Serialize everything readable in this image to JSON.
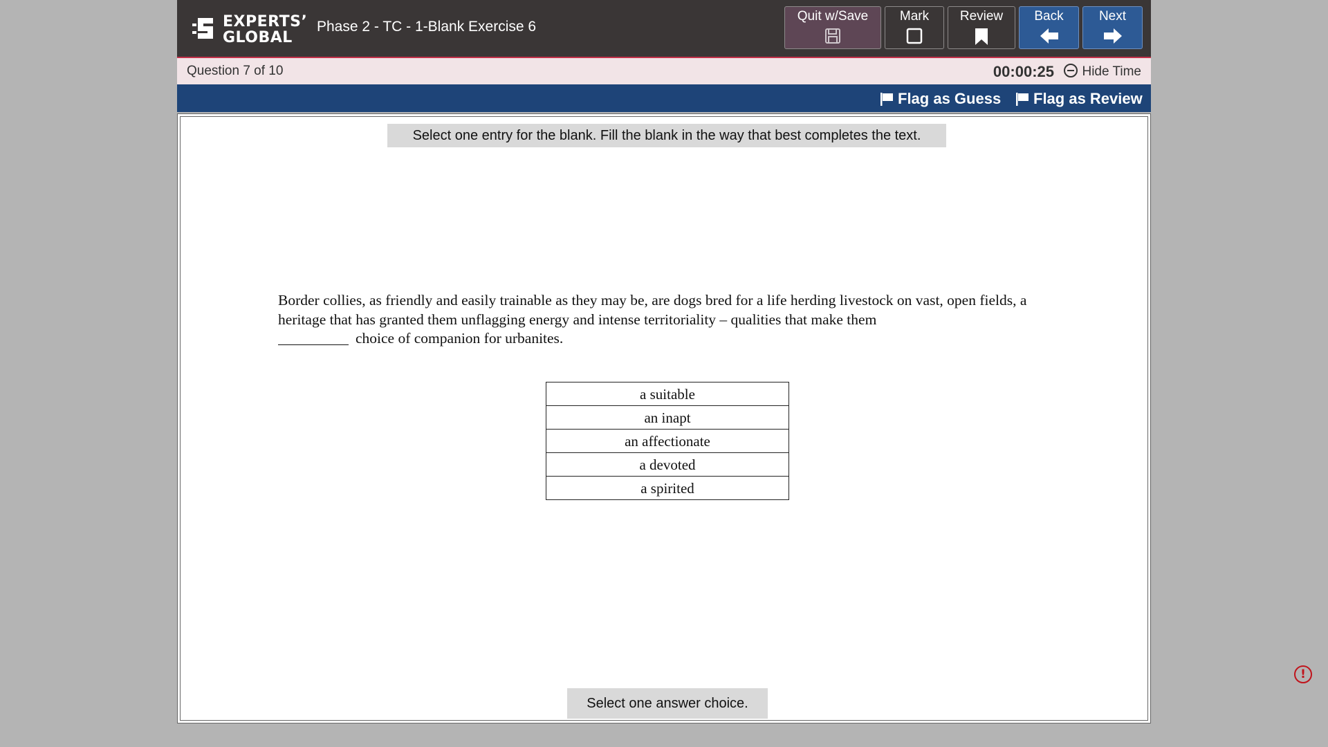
{
  "header": {
    "logo_line1": "EXPERTS’",
    "logo_line2": "GLOBAL",
    "exam_title": "Phase 2 - TC - 1-Blank Exercise 6",
    "buttons": {
      "quit": {
        "label": "Quit w/Save",
        "icon": "save-icon"
      },
      "mark": {
        "label": "Mark",
        "icon": "checkbox-icon"
      },
      "review": {
        "label": "Review",
        "icon": "bookmark-icon"
      },
      "back": {
        "label": "Back",
        "icon": "arrow-left-icon"
      },
      "next": {
        "label": "Next",
        "icon": "arrow-right-icon"
      }
    }
  },
  "question_bar": {
    "question_label": "Question 7 of 10",
    "timer": "00:00:25",
    "hide_time": "Hide Time"
  },
  "flag_bar": {
    "flag_guess": "Flag as Guess",
    "flag_review": "Flag as Review"
  },
  "question": {
    "instruction": "Select one entry for the blank. Fill the blank in the way that best completes the text.",
    "passage_before": "Border collies, as friendly and easily trainable as they may be, are dogs bred for a life herding livestock on vast, open fields, a heritage that has granted them unflagging energy and intense territoriality – qualities that make them",
    "passage_after": "choice of companion for urbanites.",
    "choices": [
      "a suitable",
      "an inapt",
      "an affectionate",
      "a devoted",
      "a spirited"
    ],
    "footer_note": "Select one answer choice."
  },
  "colors": {
    "header_bg": "#3a3636",
    "question_bar_bg": "#f2e4e7",
    "flag_bar_bg": "#1e4478",
    "nav_blue": "#2d5a95",
    "quit_bg": "#5e4655",
    "alert": "#c0141c"
  }
}
